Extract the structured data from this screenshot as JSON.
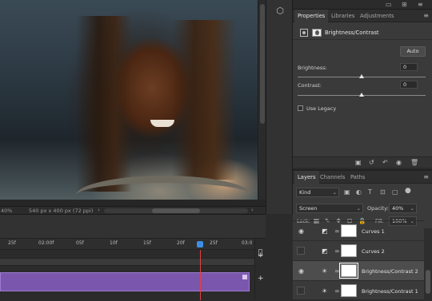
{
  "canvas": {
    "zoom": "40%",
    "doc_info": "540 px x 400 px (72 ppi)",
    "nav_arrow_left": "‹",
    "nav_arrow_right": "›"
  },
  "right_header_icons": [
    "▭",
    "⊞",
    "≡"
  ],
  "properties": {
    "tabs": [
      "Properties",
      "Libraries",
      "Adjustments"
    ],
    "menu_icon": "≡",
    "title": "Brightness/Contrast",
    "auto_label": "Auto",
    "brightness_label": "Brightness:",
    "brightness_value": "0",
    "brightness_level": 0.5,
    "contrast_label": "Contrast:",
    "contrast_value": "0",
    "contrast_level": 0.5,
    "legacy_label": "Use Legacy",
    "footer_icons": [
      "▣",
      "↺",
      "↶",
      "◉",
      "🗑"
    ]
  },
  "layers": {
    "tabs": [
      "Layers",
      "Channels",
      "Paths"
    ],
    "menu_icon": "≡",
    "filter_kind": "Kind",
    "filter_icons": [
      "▣",
      "◐",
      "T",
      "⊡",
      "▢"
    ],
    "blend_mode": "Screen",
    "opacity_label": "Opacity:",
    "opacity_value": "40%",
    "lock_label": "Lock:",
    "lock_icons": [
      "▦",
      "✎",
      "✥",
      "⊡",
      "🔒"
    ],
    "fill_label": "Fill:",
    "fill_value": "100%",
    "items": [
      {
        "name": "Curves 1",
        "visible": true,
        "selected": false,
        "adj": "◩"
      },
      {
        "name": "Curves 2",
        "visible": false,
        "selected": false,
        "adj": "◩"
      },
      {
        "name": "Brightness/Contrast 2",
        "visible": true,
        "selected": true,
        "adj": "☀"
      },
      {
        "name": "Brightness/Contrast 1",
        "visible": false,
        "selected": false,
        "adj": "☀"
      }
    ]
  },
  "timeline": {
    "ticks": [
      "25f",
      "02:00f",
      "05f",
      "10f",
      "15f",
      "20f",
      "25f",
      "03:0"
    ],
    "add_icon": "+"
  },
  "colors": {
    "accent_blue": "#3d8fe6",
    "playhead_red": "#e04040",
    "track_purple": "#7a57ad"
  }
}
